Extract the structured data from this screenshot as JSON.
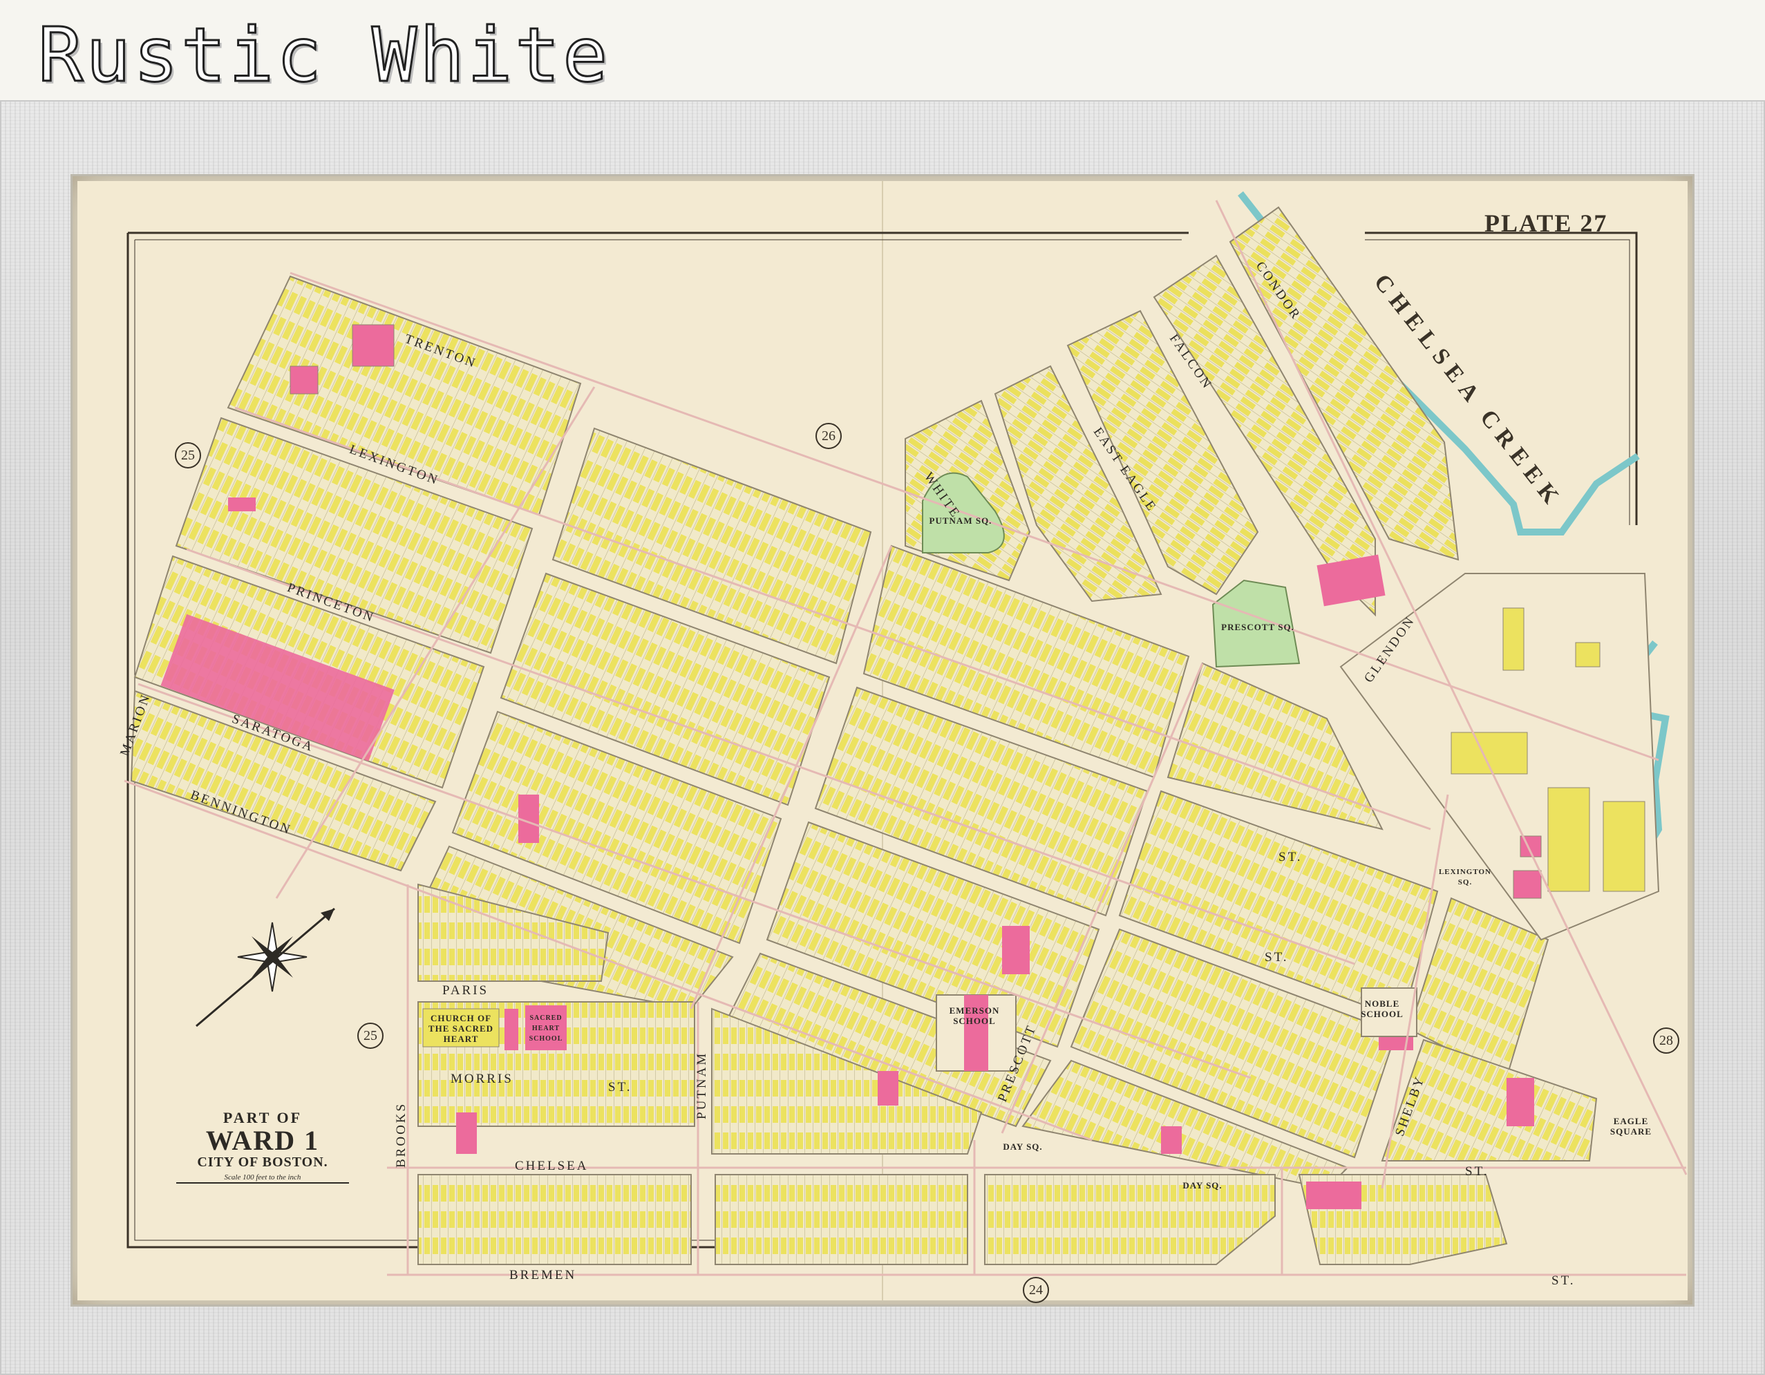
{
  "caption": "Rustic White",
  "frame": {
    "finish": "Rustic White"
  },
  "map": {
    "plate": "PLATE 27",
    "title_line1": "PART OF",
    "title_line2": "WARD 1",
    "title_line3": "CITY OF BOSTON.",
    "scale_note": "Scale 100 feet to the inch",
    "water": "CHELSEA CREEK",
    "adjacent_plates": [
      "25",
      "26",
      "25",
      "28",
      "24"
    ],
    "streets": {
      "trenton": "TRENTON",
      "lexington": "LEXINGTON",
      "princeton": "PRINCETON",
      "saratoga": "SARATOGA",
      "bennington": "BENNINGTON",
      "marion": "MARION",
      "paris": "PARIS",
      "morris": "MORRIS",
      "chelsea": "CHELSEA",
      "bremen": "BREMEN",
      "brooks": "BROOKS",
      "putnam": "PUTNAM",
      "prescott": "PRESCOTT",
      "white": "WHITE",
      "east_eagle": "EAST EAGLE",
      "falcon": "FALCON",
      "condor": "CONDOR",
      "glendon": "GLENDON",
      "shelby": "SHELBY",
      "st": "ST."
    },
    "places": {
      "putnam_sq": "PUTNAM SQ.",
      "prescott_sq": "PRESCOTT SQ.",
      "emerson_school": "EMERSON SCHOOL",
      "noble_school": "NOBLE SCHOOL",
      "church": "CHURCH OF THE SACRED HEART",
      "sacred_heart_school": "SACRED HEART SCHOOL",
      "eagle_square": "EAGLE SQUARE",
      "day_sq": "DAY SQ.",
      "lexington_sq": "LEXINGTON SQ."
    }
  }
}
